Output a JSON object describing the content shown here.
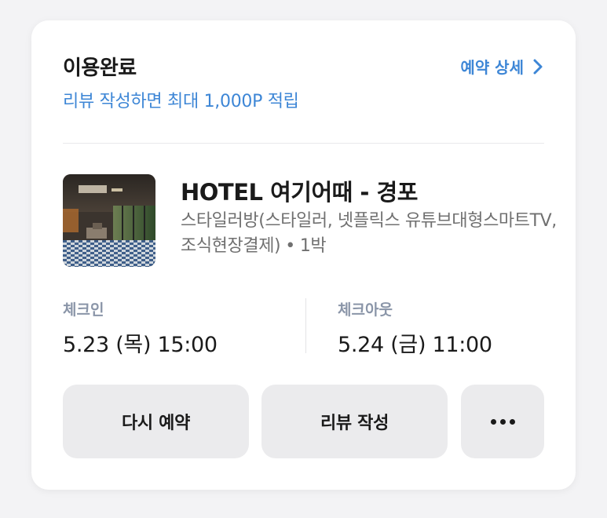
{
  "booking": {
    "status": "이용완료",
    "detail_link": "예약 상세",
    "review_promo": "리뷰 작성하면 최대 1,000P 적립"
  },
  "hotel": {
    "name": "HOTEL 여기어때 - 경포",
    "room": "스타일러방(스타일러, 넷플릭스 유튜브대형스마트TV,조식현장결제)",
    "separator": "•",
    "nights": "1박"
  },
  "check_in": {
    "label": "체크인",
    "value": "5.23 (목) 15:00"
  },
  "check_out": {
    "label": "체크아웃",
    "value": "5.24 (금) 11:00"
  },
  "actions": {
    "rebook": "다시 예약",
    "write_review": "리뷰 작성"
  },
  "colors": {
    "accent": "#3d86d6",
    "button_bg": "#ebebed",
    "label_gray": "#8a95a8"
  }
}
